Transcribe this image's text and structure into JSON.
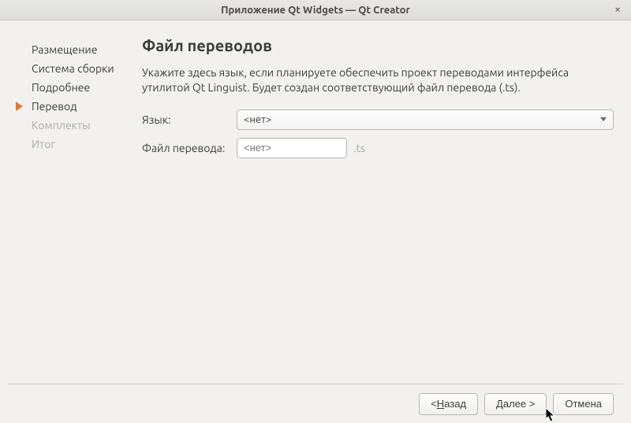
{
  "window": {
    "title": "Приложение Qt Widgets — Qt Creator"
  },
  "sidebar": {
    "items": [
      {
        "label": "Размещение",
        "state": "done"
      },
      {
        "label": "Система сборки",
        "state": "done"
      },
      {
        "label": "Подробнее",
        "state": "done"
      },
      {
        "label": "Перевод",
        "state": "current"
      },
      {
        "label": "Комплекты",
        "state": "disabled"
      },
      {
        "label": "Итог",
        "state": "disabled"
      }
    ]
  },
  "main": {
    "title": "Файл переводов",
    "description": "Укажите здесь язык, если планируете обеспечить проект переводами интерфейса утилитой Qt Linguist. Будет создан соответствующий файл перевода (.ts).",
    "language_label": "Язык:",
    "language_value": "<нет>",
    "file_label": "Файл перевода:",
    "file_placeholder": "<нет>",
    "file_suffix": ".ts"
  },
  "footer": {
    "back": {
      "prefix": "< ",
      "u": "Н",
      "rest": "азад"
    },
    "next": {
      "u": "Д",
      "rest": "алее >"
    },
    "cancel": "Отмена"
  }
}
